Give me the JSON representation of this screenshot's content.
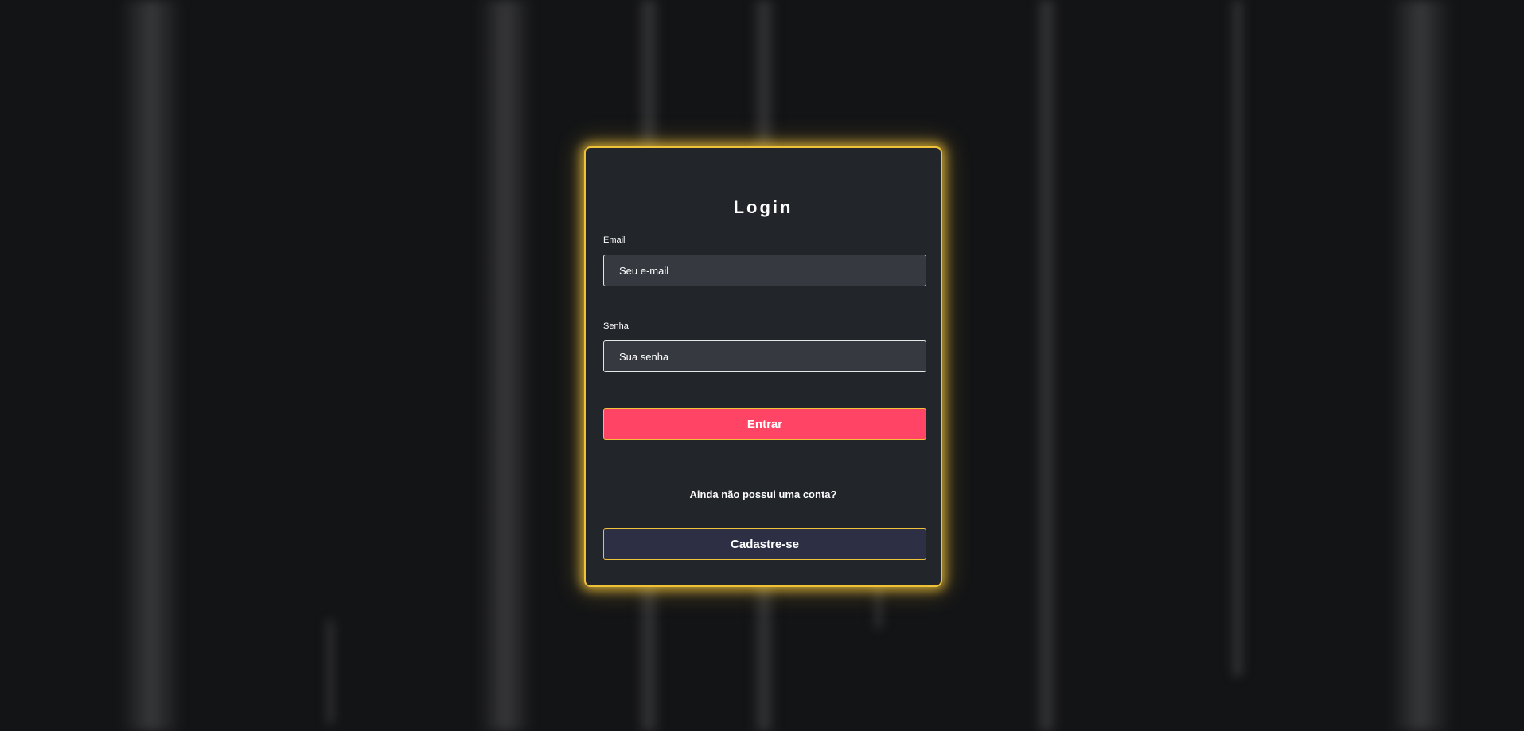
{
  "login": {
    "title": "Login",
    "email_label": "Email",
    "email_placeholder": "Seu e-mail",
    "password_label": "Senha",
    "password_placeholder": "Sua senha",
    "submit_label": "Entrar",
    "signup_prompt": "Ainda não possui uma conta?",
    "signup_label": "Cadastre-se"
  },
  "colors": {
    "background": "#131416",
    "card": "#22252a",
    "accent_glow": "#f0c23a",
    "primary_button": "#ff4466",
    "secondary_button": "#2d2f45",
    "input_bg": "#363a40"
  }
}
